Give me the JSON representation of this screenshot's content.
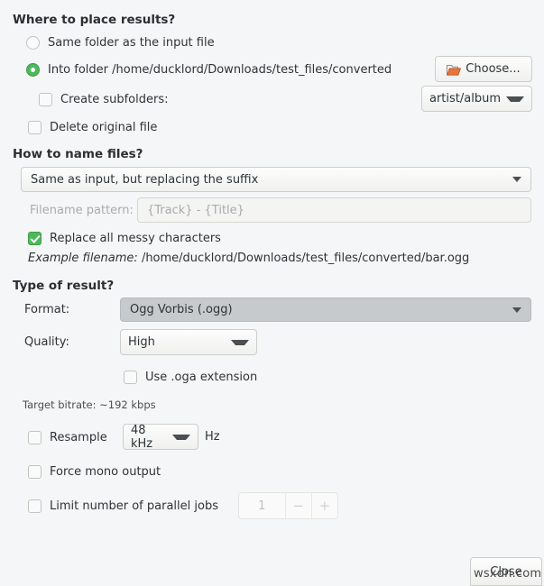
{
  "sections": {
    "where": {
      "heading": "Where to place results?",
      "same_folder_label": "Same folder as the input file",
      "into_folder_label": "Into folder /home/ducklord/Downloads/test_files/converted",
      "choose_button": "Choose...",
      "create_subfolders_label": "Create subfolders:",
      "subfolders_value": "artist/album",
      "delete_original_label": "Delete original file"
    },
    "naming": {
      "heading": "How to name files?",
      "scheme_value": "Same as input, but replacing the suffix",
      "pattern_label": "Filename pattern:",
      "pattern_placeholder": "{Track} - {Title}",
      "replace_messy_label": "Replace all messy characters",
      "example_label": "Example filename:",
      "example_value": "/home/ducklord/Downloads/test_files/converted/bar.ogg"
    },
    "result": {
      "heading": "Type of result?",
      "format_label": "Format:",
      "format_value": "Ogg Vorbis (.ogg)",
      "quality_label": "Quality:",
      "quality_value": "High",
      "oga_label": "Use .oga extension",
      "bitrate_note": "Target bitrate: ~192 kbps",
      "resample_label": "Resample",
      "resample_value": "48 kHz",
      "hz_label": "Hz",
      "mono_label": "Force mono output",
      "limit_jobs_label": "Limit number of parallel jobs",
      "jobs_value": "1",
      "jobs_minus": "−",
      "jobs_plus": "+"
    }
  },
  "footer": {
    "close_button": "Close"
  },
  "watermark": {
    "text": "wsxdn.com"
  },
  "colors": {
    "window_bg": "#f5f6f7",
    "accent_green": "#4eb95a",
    "text": "#2e3436",
    "dim_text": "#9a9d9e",
    "format_combo_bg": "#c6cacd",
    "folder_icon": "#e8763a"
  }
}
